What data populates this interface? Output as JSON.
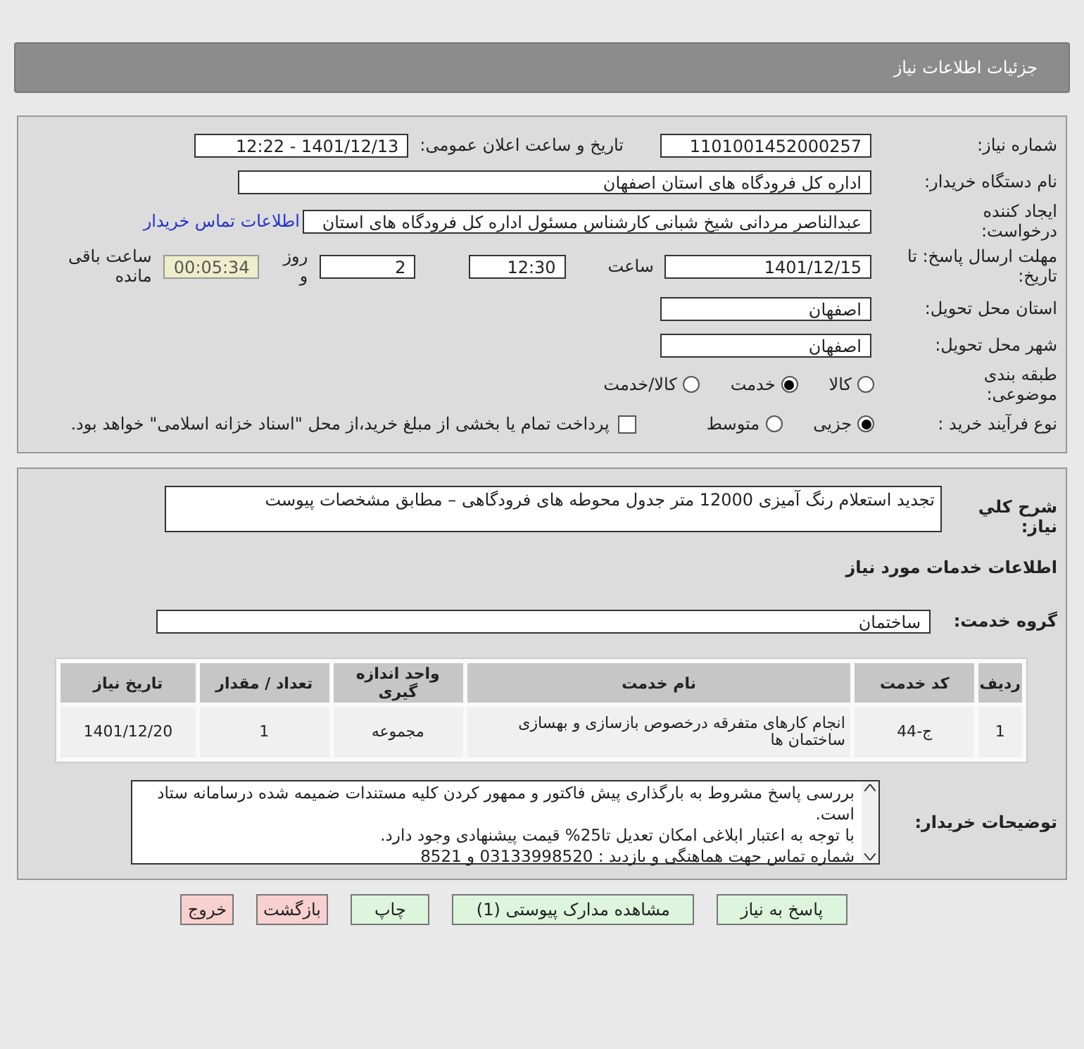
{
  "header": {
    "title": "جزئیات اطلاعات نیاز"
  },
  "details": {
    "need_number": {
      "label": "شماره نیاز:",
      "value": "1101001452000257"
    },
    "announce": {
      "label": "تاریخ و ساعت اعلان عمومی:",
      "value": "1401/12/13 - 12:22"
    },
    "buyer_org": {
      "label": "نام دستگاه خریدار:",
      "value": "اداره کل فرودگاه های استان اصفهان"
    },
    "requester": {
      "label": "ایجاد کننده درخواست:",
      "value": "عبدالناصر مردانی شیخ شبانی کارشناس مسئول  اداره کل فرودگاه های استان",
      "link": "اطلاعات تماس خریدار"
    },
    "deadline": {
      "label": "مهلت ارسال پاسخ: تا تاریخ:",
      "date": "1401/12/15",
      "time_label": "ساعت",
      "time": "12:30",
      "days": "2",
      "days_label": "روز و",
      "remaining": "00:05:34",
      "remaining_label": "ساعت باقی مانده"
    },
    "province": {
      "label": "استان محل تحویل:",
      "value": "اصفهان"
    },
    "city": {
      "label": "شهر محل تحویل:",
      "value": "اصفهان"
    },
    "category": {
      "label": "طبقه بندی موضوعی:",
      "options": [
        {
          "label": "کالا",
          "selected": false
        },
        {
          "label": "خدمت",
          "selected": true
        },
        {
          "label": "کالا/خدمت",
          "selected": false
        }
      ]
    },
    "process": {
      "label": "نوع فرآیند خرید :",
      "options": [
        {
          "label": "جزیی",
          "selected": true
        },
        {
          "label": "متوسط",
          "selected": false
        }
      ],
      "payment": {
        "label": "پرداخت تمام یا بخشی از مبلغ خرید،از محل \"اسناد خزانه اسلامی\" خواهد بود.",
        "checked": false
      }
    }
  },
  "need": {
    "summary": {
      "label": "شرح کلي نياز:",
      "value": "تجدید استعلام رنگ آمیزی 12000 متر جدول محوطه های فرودگاهی – مطابق مشخصات پیوست"
    },
    "services_title": "اطلاعات خدمات مورد نیاز",
    "service_group": {
      "label": "گروه خدمت:",
      "value": "ساختمان"
    },
    "table": {
      "columns": [
        "ردیف",
        "کد خدمت",
        "نام خدمت",
        "واحد اندازه گیری",
        "تعداد / مقدار",
        "تاریخ نیاز"
      ],
      "rows": [
        [
          "1",
          "ج-44",
          "انجام کارهای متفرقه درخصوص بازسازی و بهسازی ساختمان ها",
          "مجموعه",
          "1",
          "1401/12/20"
        ]
      ]
    },
    "buyer_notes": {
      "label": "توضیحات خریدار:",
      "lines": [
        "بررسی پاسخ مشروط  به بارگذاری پیش فاکتور و ممهور کردن کلیه مستندات ضمیمه شده درسامانه ستاد است.",
        "با توجه به اعتبار ابلاغی امکان تعدیل تا25% قیمت پیشنهادی وجود دارد.",
        "شماره تماس جهت هماهنگی و  بازدید : 03133998520 و 8521"
      ]
    }
  },
  "buttons": [
    {
      "label": "پاسخ به نیاز",
      "kind": "green"
    },
    {
      "label": "مشاهده مدارک پیوستی (1)",
      "kind": "green"
    },
    {
      "label": "چاپ",
      "kind": "green"
    },
    {
      "label": "بازگشت",
      "kind": "red"
    },
    {
      "label": "خروج",
      "kind": "red"
    }
  ]
}
